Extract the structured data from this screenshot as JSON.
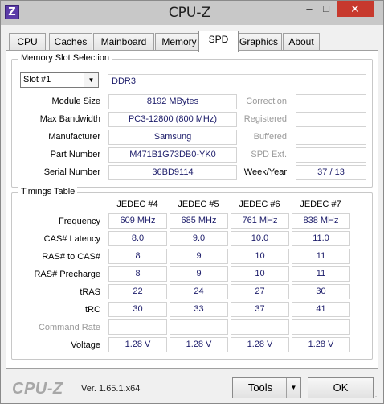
{
  "window": {
    "title": "CPU-Z",
    "icon_letter": "Z",
    "min_glyph": "–",
    "max_glyph": "□",
    "close_glyph": "✕"
  },
  "tabs": [
    "CPU",
    "Caches",
    "Mainboard",
    "Memory",
    "SPD",
    "Graphics",
    "About"
  ],
  "active_tab": "SPD",
  "memory_slot": {
    "group_title": "Memory Slot Selection",
    "slot": "Slot #1",
    "type": "DDR3",
    "rows": [
      {
        "label": "Module Size",
        "value": "8192 MBytes",
        "rlabel": "Correction",
        "rvalue": ""
      },
      {
        "label": "Max Bandwidth",
        "value": "PC3-12800 (800 MHz)",
        "rlabel": "Registered",
        "rvalue": ""
      },
      {
        "label": "Manufacturer",
        "value": "Samsung",
        "rlabel": "Buffered",
        "rvalue": ""
      },
      {
        "label": "Part Number",
        "value": "M471B1G73DB0-YK0",
        "rlabel": "SPD Ext.",
        "rvalue": ""
      },
      {
        "label": "Serial Number",
        "value": "36BD9114",
        "rlabel": "Week/Year",
        "rvalue": "37 / 13"
      }
    ]
  },
  "timings": {
    "group_title": "Timings Table",
    "columns": [
      "JEDEC #4",
      "JEDEC #5",
      "JEDEC #6",
      "JEDEC #7"
    ],
    "rows": [
      {
        "label": "Frequency",
        "values": [
          "609 MHz",
          "685 MHz",
          "761 MHz",
          "838 MHz"
        ]
      },
      {
        "label": "CAS# Latency",
        "values": [
          "8.0",
          "9.0",
          "10.0",
          "11.0"
        ]
      },
      {
        "label": "RAS# to CAS#",
        "values": [
          "8",
          "9",
          "10",
          "11"
        ]
      },
      {
        "label": "RAS# Precharge",
        "values": [
          "8",
          "9",
          "10",
          "11"
        ]
      },
      {
        "label": "tRAS",
        "values": [
          "22",
          "24",
          "27",
          "30"
        ]
      },
      {
        "label": "tRC",
        "values": [
          "30",
          "33",
          "37",
          "41"
        ]
      },
      {
        "label": "Command Rate",
        "values": [
          "",
          "",
          "",
          ""
        ]
      },
      {
        "label": "Voltage",
        "values": [
          "1.28 V",
          "1.28 V",
          "1.28 V",
          "1.28 V"
        ]
      }
    ]
  },
  "footer": {
    "brand": "CPU-Z",
    "version": "Ver. 1.65.1.x64",
    "tools_label": "Tools",
    "ok_label": "OK"
  }
}
